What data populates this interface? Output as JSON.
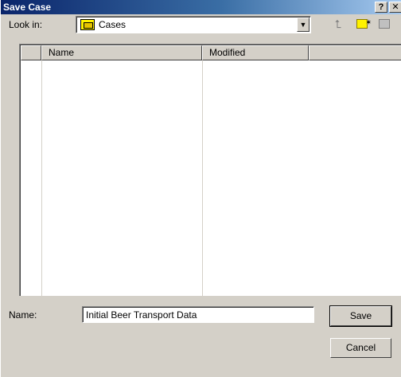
{
  "window": {
    "title": "Save Case",
    "help_button": "?",
    "close_button": "✕"
  },
  "lookin": {
    "label": "Look in:",
    "value": "Cases"
  },
  "toolbar": {
    "up_icon": "up-folder-icon",
    "new_icon": "new-folder-icon",
    "view_icon": "view-menu-icon"
  },
  "filelist": {
    "columns": [
      "",
      "Name",
      "Modified",
      ""
    ],
    "rows": []
  },
  "name_field": {
    "label": "Name:",
    "value": "Initial Beer Transport Data"
  },
  "buttons": {
    "save": "Save",
    "cancel": "Cancel"
  }
}
